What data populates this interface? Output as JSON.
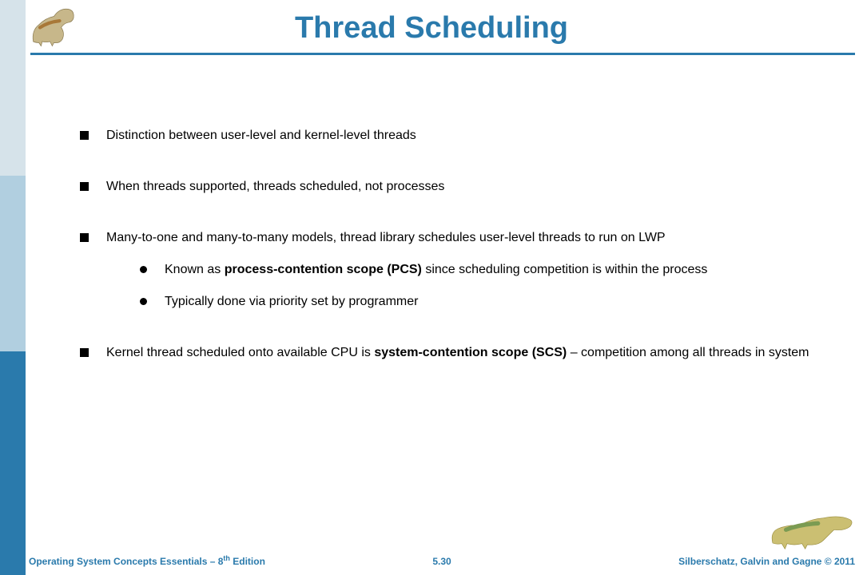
{
  "title": "Thread Scheduling",
  "bullets": [
    {
      "text": "Distinction between user-level and kernel-level threads"
    },
    {
      "text": "When threads supported, threads scheduled, not processes"
    },
    {
      "text": "Many-to-one and many-to-many models, thread library schedules user-level threads to run on LWP",
      "sub": [
        {
          "pre": "Known as ",
          "bold": "process-contention scope (PCS)",
          "post": " since scheduling competition is within the process"
        },
        {
          "pre": "Typically done via priority set by programmer",
          "bold": "",
          "post": ""
        }
      ]
    },
    {
      "pre": "Kernel thread scheduled onto available CPU is ",
      "bold": "system-contention scope (SCS)",
      "post": " – competition among all threads in system"
    }
  ],
  "footer": {
    "left_pre": "Operating System Concepts Essentials – 8",
    "left_sup": "th",
    "left_post": " Edition",
    "center": "5.30",
    "right": "Silberschatz, Galvin and Gagne © 2011"
  }
}
